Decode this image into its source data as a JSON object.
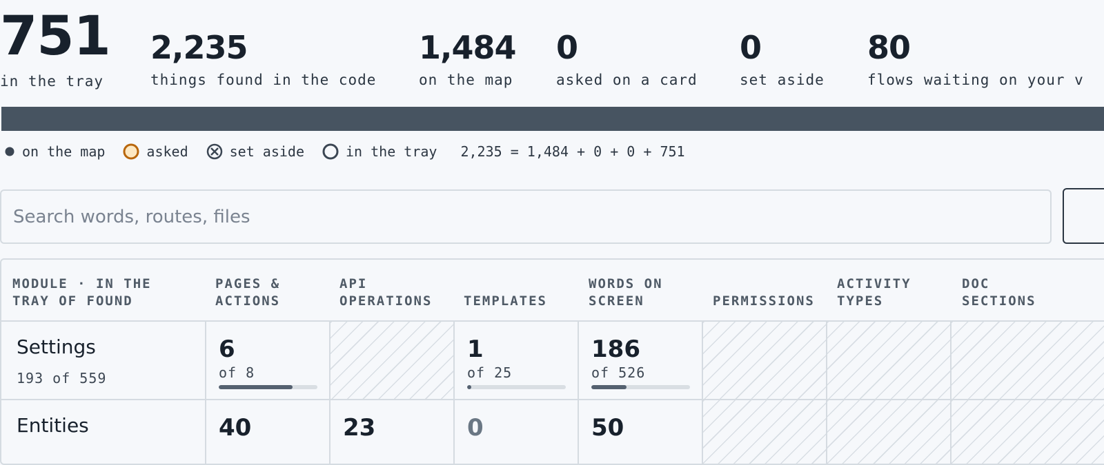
{
  "stats": [
    {
      "value": "751",
      "label": "in the tray"
    },
    {
      "value": "2,235",
      "label": "things found in the code"
    },
    {
      "value": "1,484",
      "label": "on the map"
    },
    {
      "value": "0",
      "label": "asked on a card"
    },
    {
      "value": "0",
      "label": "set aside"
    },
    {
      "value": "80",
      "label": "flows waiting on your v"
    }
  ],
  "legend": {
    "items": [
      {
        "label": "on the map",
        "icon": "filled-dot-icon"
      },
      {
        "label": "asked",
        "icon": "asked-ring-icon",
        "color": "#b8660b"
      },
      {
        "label": "set aside",
        "icon": "x-circle-icon"
      },
      {
        "label": "in the tray",
        "icon": "empty-ring-icon"
      }
    ],
    "equation": "2,235 = 1,484 + 0 + 0 + 751"
  },
  "search": {
    "placeholder": "Search words, routes, files",
    "value": ""
  },
  "table": {
    "headers": [
      [
        "MODULE · IN THE",
        "TRAY OF FOUND"
      ],
      [
        "PAGES &",
        "ACTIONS"
      ],
      [
        "API",
        "OPERATIONS"
      ],
      [
        "TEMPLATES"
      ],
      [
        "WORDS ON",
        "SCREEN"
      ],
      [
        "PERMISSIONS"
      ],
      [
        "ACTIVITY",
        "TYPES"
      ],
      [
        "DOC",
        "SECTIONS"
      ]
    ],
    "rows": [
      {
        "module": "Settings",
        "module_sub": "193 of 559",
        "cells": [
          {
            "value": "6",
            "of": "of 8",
            "fraction": 0.75
          },
          null,
          {
            "value": "1",
            "of": "of 25",
            "fraction": 0.04
          },
          {
            "value": "186",
            "of": "of 526",
            "fraction": 0.354
          },
          null,
          null,
          null
        ]
      },
      {
        "module": "Entities",
        "module_sub": "",
        "cells": [
          {
            "value": "40",
            "of": "",
            "fraction": null
          },
          {
            "value": "23",
            "of": "",
            "fraction": null
          },
          {
            "value": "0",
            "of": "",
            "fraction": null
          },
          {
            "value": "50",
            "of": "",
            "fraction": null
          },
          null,
          null,
          null
        ]
      }
    ]
  },
  "colors": {
    "bar": "#475461",
    "accent_asked": "#b8660b",
    "text": "#18212c"
  }
}
